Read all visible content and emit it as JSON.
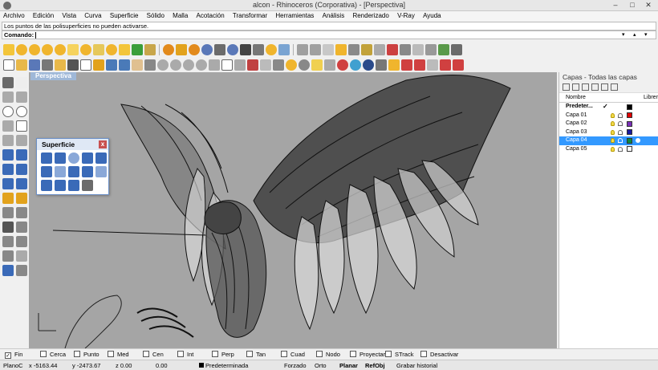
{
  "window": {
    "title": "alcon - Rhinoceros (Corporativa) - [Perspectiva]"
  },
  "menu": [
    "Archivo",
    "Edición",
    "Vista",
    "Curva",
    "Superficie",
    "Sólido",
    "Malla",
    "Acotación",
    "Transformar",
    "Herramientas",
    "Análisis",
    "Renderizado",
    "V-Ray",
    "Ayuda"
  ],
  "command": {
    "history": "Los puntos de las polisuperficies no pueden activarse.",
    "prompt": "Comando:"
  },
  "viewport": {
    "label": "Perspectiva"
  },
  "layers_panel": {
    "title": "Capas - Todas las capas",
    "col_name": "Nombre",
    "col_material": "Librer",
    "rows": [
      {
        "name": "Predeter...",
        "color": "#000000",
        "check": "✓"
      },
      {
        "name": "Capa 01",
        "color": "#e00000"
      },
      {
        "name": "Capa 02",
        "color": "#7a2fb8"
      },
      {
        "name": "Capa 03",
        "color": "#1a1aa0"
      },
      {
        "name": "Capa 04",
        "color": "#0e8a3a"
      },
      {
        "name": "Capa 05",
        "color": "#ffffff"
      }
    ]
  },
  "float_panel": {
    "title": "Superficie",
    "close": "x"
  },
  "osnaps": [
    {
      "label": "Fin",
      "checked": true
    },
    {
      "label": "Cerca",
      "checked": false
    },
    {
      "label": "Punto",
      "checked": false
    },
    {
      "label": "Med",
      "checked": false
    },
    {
      "label": "Cen",
      "checked": false
    },
    {
      "label": "Int",
      "checked": false
    },
    {
      "label": "Perp",
      "checked": false
    },
    {
      "label": "Tan",
      "checked": false
    },
    {
      "label": "Cuad",
      "checked": false
    },
    {
      "label": "Nodo",
      "checked": false
    },
    {
      "label": "Proyectar",
      "checked": false
    },
    {
      "label": "STrack",
      "checked": false
    },
    {
      "label": "Desactivar",
      "checked": false
    }
  ],
  "status": {
    "plane": "PlanoC",
    "x": "x -5163.44",
    "y": "y -2473.67",
    "z": "z 0.00",
    "dist": "0.00",
    "layer": "Predeterminada",
    "modes": [
      "Forzado",
      "Orto",
      "Planar",
      "RefObj",
      "Grabar historial"
    ]
  },
  "colors": {
    "viewport_bg": "#a5a5a5",
    "selection": "#3399ff"
  },
  "icons": {
    "snapbar_checkbox": "checkbox-icon",
    "window_controls": [
      "minimize-icon",
      "maximize-icon",
      "close-icon"
    ]
  }
}
